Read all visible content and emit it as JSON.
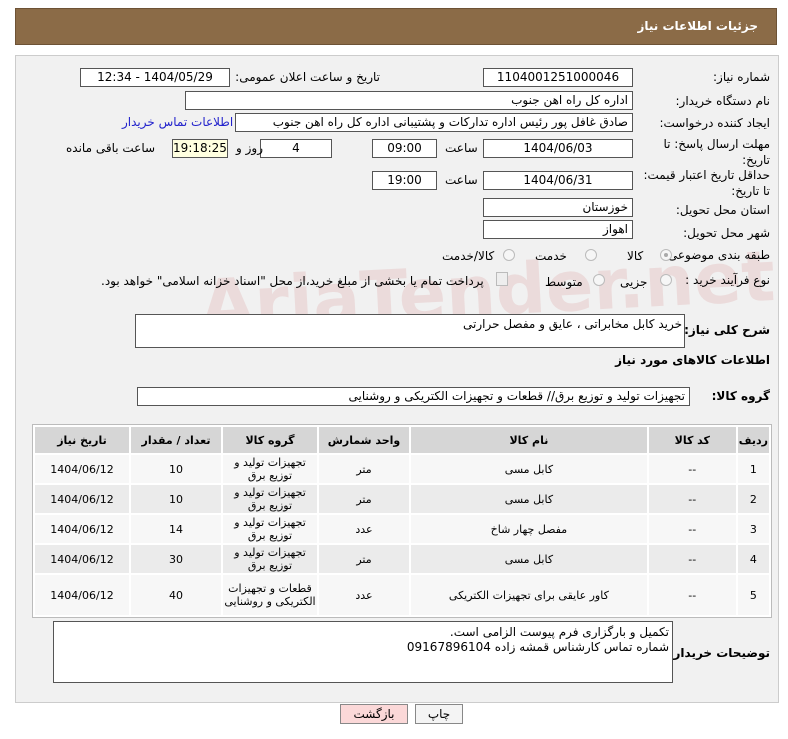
{
  "header": {
    "title": "جزئیات اطلاعات نیاز"
  },
  "watermark": "AriaTender.net",
  "form": {
    "need_number_label": "شماره نیاز:",
    "need_number": "1104001251000046",
    "announce_label": "تاریخ و ساعت اعلان عمومی:",
    "announce_value": "1404/05/29 - 12:34",
    "buyer_org_label": "نام دستگاه خریدار:",
    "buyer_org": "اداره کل راه اهن جنوب",
    "creator_label": "ایجاد کننده درخواست:",
    "creator": "صادق غافل پور رئیس اداره تدارکات و پشتیبانی اداره کل راه اهن جنوب",
    "contact_link": "اطلاعات تماس خریدار",
    "deadline_label": "مهلت ارسال پاسخ: تا تاریخ:",
    "deadline_date": "1404/06/03",
    "time_label": "ساعت",
    "deadline_time": "09:00",
    "days": "4",
    "days_label": "روز و",
    "remaining": "19:18:25",
    "remaining_label": "ساعت باقی مانده",
    "validity_label": "حداقل تاریخ اعتبار قیمت: تا تاریخ:",
    "validity_date": "1404/06/31",
    "validity_time": "19:00",
    "province_label": "استان محل تحویل:",
    "province": "خوزستان",
    "city_label": "شهر محل تحویل:",
    "city": "اهواز",
    "category_label": "طبقه بندی موضوعی:",
    "category_options": [
      "کالا",
      "خدمت",
      "کالا/خدمت"
    ],
    "process_label": "نوع فرآیند خرید :",
    "process_options": [
      "جزیی",
      "متوسط"
    ],
    "payment_note": "پرداخت تمام یا بخشی از مبلغ خرید،از محل \"اسناد خزانه اسلامی\" خواهد بود.",
    "description_label": "شرح کلی نیاز:",
    "description": "خرید کابل مخابراتی ، عایق و مفصل حرارتی",
    "goods_section_title": "اطلاعات کالاهای مورد نیاز",
    "goods_group_label": "گروه کالا:",
    "goods_group": "تجهیزات تولید و توزیع برق// قطعات و تجهیزات الکتریکی و روشنایی"
  },
  "table": {
    "headers": [
      "ردیف",
      "کد کالا",
      "نام کالا",
      "واحد شمارش",
      "گروه کالا",
      "تعداد / مقدار",
      "تاریخ نیاز"
    ],
    "rows": [
      [
        "1",
        "--",
        "کابل مسی",
        "متر",
        "تجهیزات تولید و توزیع برق",
        "10",
        "1404/06/12"
      ],
      [
        "2",
        "--",
        "کابل مسی",
        "متر",
        "تجهیزات تولید و توزیع برق",
        "10",
        "1404/06/12"
      ],
      [
        "3",
        "--",
        "مفصل چهار شاخ",
        "عدد",
        "تجهیزات تولید و توزیع برق",
        "14",
        "1404/06/12"
      ],
      [
        "4",
        "--",
        "کابل مسی",
        "متر",
        "تجهیزات تولید و توزیع برق",
        "30",
        "1404/06/12"
      ],
      [
        "5",
        "--",
        "کاور عایقی برای تجهیزات الکتریکی",
        "عدد",
        "قطعات و تجهیزات الکتریکی و روشنایی",
        "40",
        "1404/06/12"
      ]
    ]
  },
  "notes": {
    "label": "توضیحات خریدار:",
    "line1": "تکمیل و بارگزاری فرم پیوست الزامی است.",
    "line2": "شماره تماس کارشناس   قمشه زاده 09167896104"
  },
  "buttons": {
    "print": "چاپ",
    "back": "بازگشت"
  }
}
